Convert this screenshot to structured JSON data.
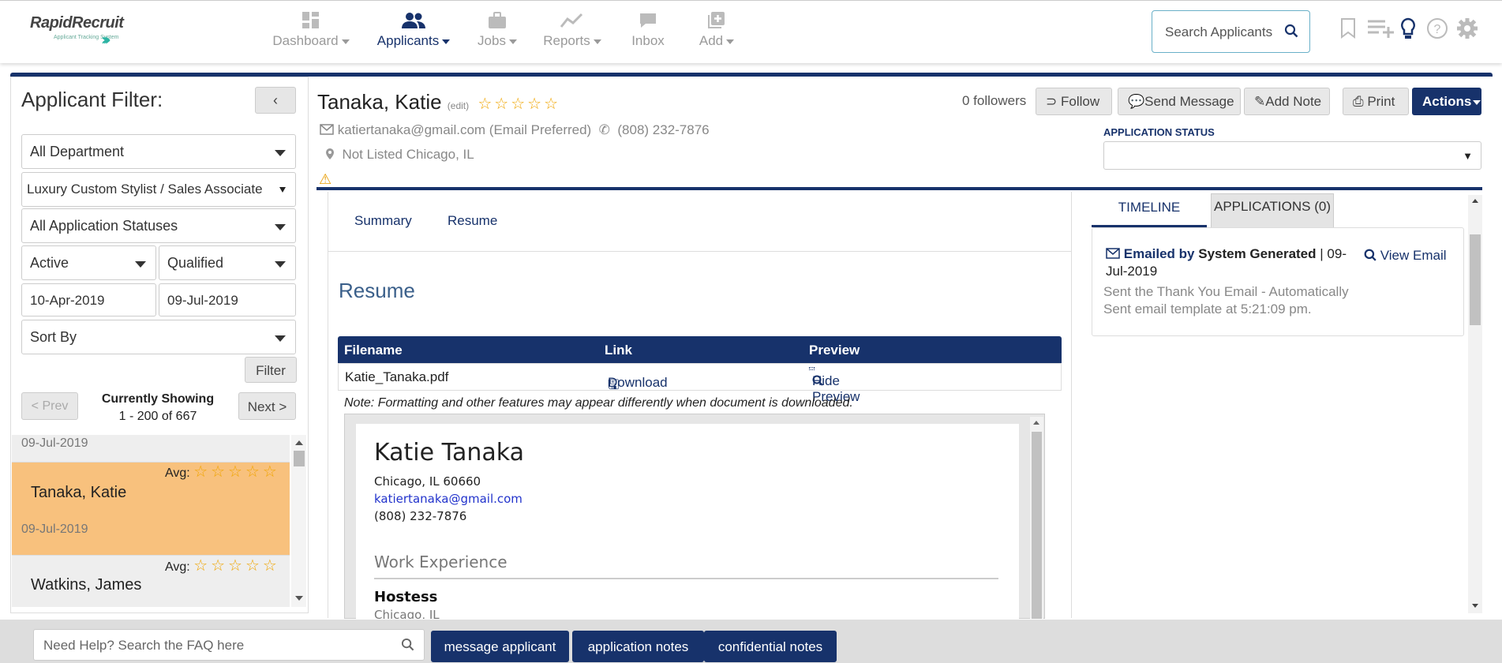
{
  "app": {
    "logo_text": "RapidRecruit",
    "logo_sub": "Applicant Tracking System"
  },
  "nav": [
    {
      "label": "Dashboard",
      "icon": "dashboard-icon"
    },
    {
      "label": "Applicants",
      "icon": "people-icon",
      "active": true
    },
    {
      "label": "Jobs",
      "icon": "briefcase-icon"
    },
    {
      "label": "Reports",
      "icon": "line-chart-icon"
    },
    {
      "label": "Inbox",
      "icon": "chat-icon"
    },
    {
      "label": "Add",
      "icon": "plus-square-icon"
    }
  ],
  "search": {
    "placeholder": "Search Applicants"
  },
  "filter": {
    "title": "Applicant Filter:",
    "collapse_label": "‹",
    "department": "All Department",
    "job": "Luxury Custom Stylist / Sales Associate",
    "status": "All Application Statuses",
    "state": "Active",
    "qualification": "Qualified",
    "date_from": "10-Apr-2019",
    "date_to": "09-Jul-2019",
    "sort": "Sort By",
    "filter_btn": "Filter",
    "prev_btn": "< Prev",
    "next_btn": "Next >",
    "showing_label": "Currently Showing",
    "showing_range": "1 - 200 of 667"
  },
  "applicants": [
    {
      "name": "",
      "date": "09-Jul-2019",
      "avg_label": "",
      "stars": ""
    },
    {
      "name": "Tanaka, Katie",
      "date": "09-Jul-2019",
      "avg_label": "Avg:",
      "stars": "☆☆☆☆☆"
    },
    {
      "name": "Watkins, James",
      "date": "",
      "avg_label": "Avg:",
      "stars": "☆☆☆☆☆"
    }
  ],
  "applicant": {
    "name": "Tanaka, Katie",
    "edit_label": "(edit)",
    "stars": "☆☆☆☆☆",
    "email": "katiertanaka@gmail.com (Email Preferred)",
    "phone": "(808) 232-7876",
    "location": "Not Listed Chicago, IL",
    "followers": "0 followers"
  },
  "actions": {
    "follow": "Follow",
    "send_message": "Send Message",
    "add_note": "Add Note",
    "print": "Print",
    "actions": "Actions"
  },
  "application_status": {
    "label": "APPLICATION STATUS",
    "value": ""
  },
  "tabs": {
    "summary": "Summary",
    "resume": "Resume"
  },
  "resume": {
    "heading": "Resume",
    "columns": [
      "Filename",
      "Link",
      "Preview"
    ],
    "filename": "Katie_Tanaka.pdf",
    "download": "Download",
    "hide_preview": "Hide Preview",
    "note": "Note: Formatting and other features may appear differently when document is downloaded."
  },
  "cv": {
    "name": "Katie Tanaka",
    "city": "Chicago, IL 60660",
    "email": "katiertanaka@gmail.com",
    "phone": "(808) 232-7876",
    "section": "Work Experience",
    "job_title": "Hostess",
    "job_location": "Chicago, IL"
  },
  "right_tabs": {
    "timeline": "TIMELINE",
    "applications": "APPLICATIONS (0)"
  },
  "timeline": {
    "title_prefix": "Emailed by",
    "author": "System Generated",
    "date": "| 09-Jul-2019",
    "view": "View Email",
    "body": "Sent the Thank You Email - Automatically Sent email template at 5:21:09 pm."
  },
  "bottom": {
    "faq_placeholder": "Need Help? Search the FAQ here",
    "message_applicant": "message applicant",
    "application_notes": "application notes",
    "confidential_notes": "confidential notes"
  },
  "colors": {
    "navy": "#17326b",
    "selected_row": "#f8c17d",
    "star": "#f0a500",
    "accent_teal": "#2bb3a3"
  }
}
